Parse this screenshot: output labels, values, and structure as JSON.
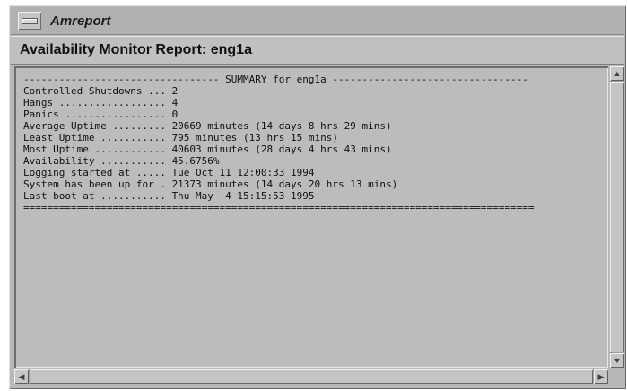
{
  "window": {
    "title": "Amreport",
    "menu_icon": "window-menu-icon"
  },
  "report": {
    "heading": "Availability Monitor Report: eng1a",
    "lines": [
      "--------------------------------- SUMMARY for eng1a ---------------------------------",
      "Controlled Shutdowns ... 2",
      "Hangs .................. 4",
      "Panics ................. 0",
      "Average Uptime ......... 20669 minutes (14 days 8 hrs 29 mins)",
      "Least Uptime ........... 795 minutes (13 hrs 15 mins)",
      "Most Uptime ............ 40603 minutes (28 days 4 hrs 43 mins)",
      "Availability ........... 45.6756%",
      "Logging started at ..... Tue Oct 11 12:00:33 1994",
      "System has been up for . 21373 minutes (14 days 20 hrs 13 mins)",
      "Last boot at ........... Thu May  4 15:15:53 1995",
      "======================================================================================"
    ]
  },
  "scrollbars": {
    "up_icon": "scroll-up-arrow-icon",
    "down_icon": "scroll-down-arrow-icon",
    "left_icon": "scroll-left-arrow-icon",
    "right_icon": "scroll-right-arrow-icon",
    "up_glyph": "▲",
    "down_glyph": "▼",
    "left_glyph": "◀",
    "right_glyph": "▶"
  },
  "colors": {
    "window_bg": "#b8b8b8",
    "text": "#111111"
  }
}
